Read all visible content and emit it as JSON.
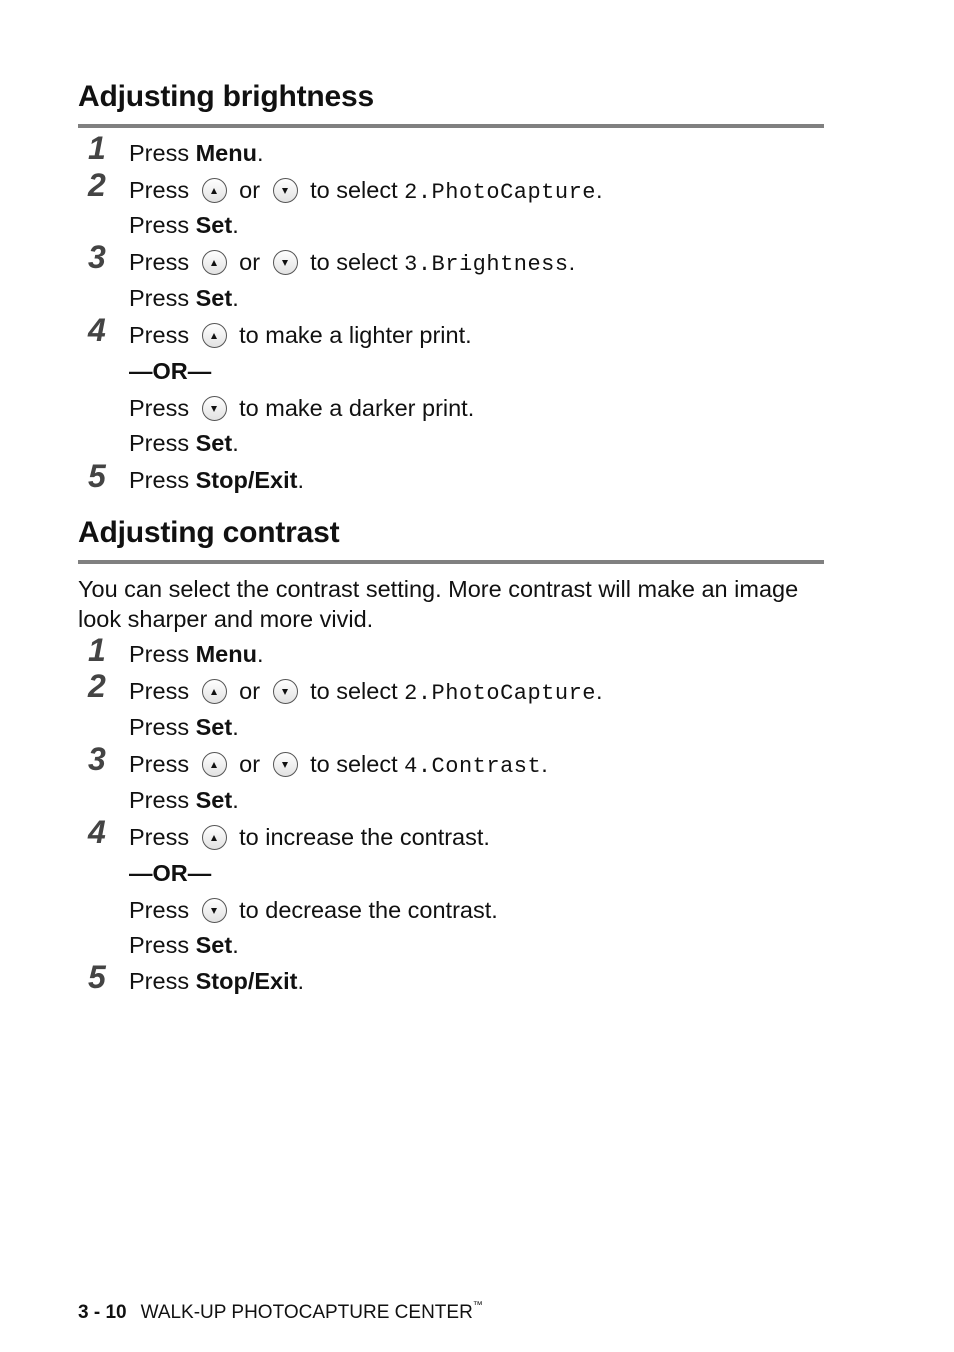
{
  "sections": [
    {
      "title": "Adjusting brightness",
      "steps": {
        "s1": {
          "num": "1",
          "press": "Press ",
          "key": "Menu",
          "end": "."
        },
        "s2": {
          "num": "2",
          "press": "Press ",
          "or": " or ",
          "select": " to select ",
          "value": "2.PhotoCapture",
          "end": ".",
          "set_press": "Press ",
          "set_key": "Set",
          "set_end": "."
        },
        "s3": {
          "num": "3",
          "press": "Press ",
          "or": " or ",
          "select": " to select ",
          "value": "3.Brightness",
          "end": ".",
          "set_press": "Press ",
          "set_key": "Set",
          "set_end": "."
        },
        "s4": {
          "num": "4",
          "press": "Press ",
          "up_text": " to make a lighter print.",
          "or_divider": "—OR—",
          "down_text": " to make a darker print.",
          "set_press": "Press ",
          "set_key": "Set",
          "set_end": "."
        },
        "s5": {
          "num": "5",
          "press": "Press ",
          "key": "Stop/Exit",
          "end": "."
        }
      }
    },
    {
      "title": "Adjusting contrast",
      "intro": "You can select the contrast setting. More contrast will make an image look sharper and more vivid.",
      "steps": {
        "s1": {
          "num": "1",
          "press": "Press ",
          "key": "Menu",
          "end": "."
        },
        "s2": {
          "num": "2",
          "press": "Press ",
          "or": " or ",
          "select": " to select ",
          "value": "2.PhotoCapture",
          "end": ".",
          "set_press": "Press ",
          "set_key": "Set",
          "set_end": "."
        },
        "s3": {
          "num": "3",
          "press": "Press ",
          "or": " or ",
          "select": " to select ",
          "value": "4.Contrast",
          "end": ".",
          "set_press": "Press ",
          "set_key": "Set",
          "set_end": "."
        },
        "s4": {
          "num": "4",
          "press": "Press ",
          "up_text": " to increase the contrast.",
          "or_divider": "—OR—",
          "down_text": " to decrease the contrast.",
          "set_press": "Press ",
          "set_key": "Set",
          "set_end": "."
        },
        "s5": {
          "num": "5",
          "press": "Press ",
          "key": "Stop/Exit",
          "end": "."
        }
      }
    }
  ],
  "icons": {
    "up": "up-arrow-key-icon",
    "down": "down-arrow-key-icon"
  },
  "footer": {
    "page": "3 - 10",
    "title": "WALK-UP PHOTOCAPTURE CENTER",
    "tm": "™"
  },
  "colors": {
    "rule": "#808080",
    "step_number": "#444444",
    "text": "#111111"
  }
}
